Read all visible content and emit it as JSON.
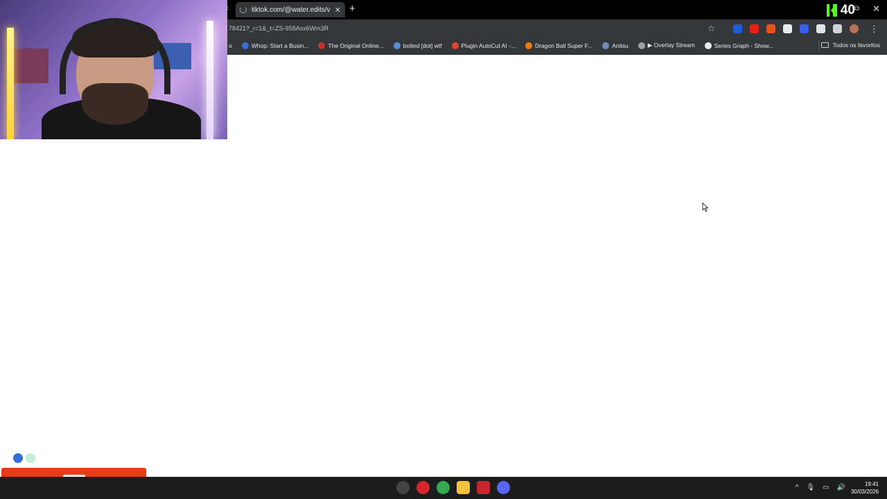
{
  "browser": {
    "active_tab_title": "tiktok.com/@water.edits/video...",
    "address_text": "78421?_r=1&_t=ZS-958Asx6Wm3R",
    "tab_scroll_left_glyph": "‹",
    "new_tab_glyph": "+",
    "close_glyph": "✕",
    "menu_glyph": "⋮",
    "star_glyph": "☆"
  },
  "stream_overlay": {
    "viewer_count": "40",
    "brand_color": "#53fc18"
  },
  "bookmarks": {
    "leading_fragment": "o",
    "items": [
      {
        "label": "Whop: Start a Busin...",
        "icon": "whop-icon",
        "color": "#3b6bd6"
      },
      {
        "label": "The Original Online...",
        "icon": "original-icon",
        "color": "#c0342a"
      },
      {
        "label": "botted [dot] wtf",
        "icon": "bot-icon",
        "color": "#5a8fd8"
      },
      {
        "label": "Plugin AutoCut AI -...",
        "icon": "autocut-icon",
        "color": "#e2442b"
      },
      {
        "label": "Dragon Ball Super F...",
        "icon": "dragonball-icon",
        "color": "#f07a14"
      },
      {
        "label": "Anitsu",
        "icon": "anitsu-icon",
        "color": "#6f8fb8"
      },
      {
        "label": "▶ Overlay Stream",
        "icon": "globe-icon",
        "color": "#9aa0a6"
      },
      {
        "label": "Series Graph - Show...",
        "icon": "seriesgraph-icon",
        "color": "#e8eaed"
      }
    ],
    "all_bookmarks_label": "Todos os favoritos"
  },
  "extensions": [
    {
      "name": "ext-counter-icon",
      "color": "#1d5fd1"
    },
    {
      "name": "ext-youtube-icon",
      "color": "#e62117"
    },
    {
      "name": "ext-fox-icon",
      "color": "#e6531d"
    },
    {
      "name": "ext-bubble-icon",
      "color": "#e8eaed"
    },
    {
      "name": "ext-circle-icon",
      "color": "#3a5ee8"
    },
    {
      "name": "ext-cloud-icon",
      "color": "#dfe3e8"
    },
    {
      "name": "ext-puzzle-icon",
      "color": "#cfd2d6"
    },
    {
      "name": "profile-avatar-icon",
      "color": "#b5735a"
    }
  ],
  "taskbar": {
    "apps": [
      {
        "name": "windows-start-icon",
        "color": "#3ea0ff"
      },
      {
        "name": "obs-icon",
        "color": "#444444"
      },
      {
        "name": "opera-icon",
        "color": "#d7252f"
      },
      {
        "name": "chrome-icon",
        "color": "#34a853"
      },
      {
        "name": "file-explorer-icon",
        "color": "#f3c23c"
      },
      {
        "name": "recorder-app-icon",
        "color": "#c8262c"
      },
      {
        "name": "discord-icon",
        "color": "#5865f2"
      }
    ],
    "tray": {
      "chevron": "^",
      "mic": "🎙",
      "network": "▭",
      "volume": "🔊"
    },
    "clock_time": "19:41",
    "clock_date": "30/03/2026"
  }
}
